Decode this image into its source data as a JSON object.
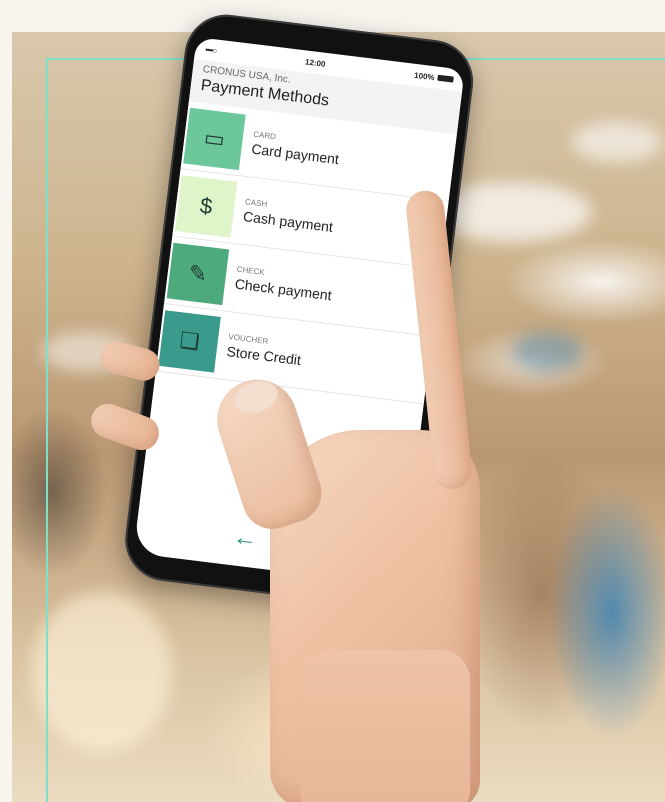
{
  "status_bar": {
    "signal": "••••○",
    "time": "12:00",
    "battery": "100%"
  },
  "header": {
    "company": "CRONUS USA, Inc.",
    "title": "Payment Methods"
  },
  "payment_methods": [
    {
      "kind": "CARD",
      "label": "Card payment",
      "icon": "credit-card-icon"
    },
    {
      "kind": "CASH",
      "label": "Cash payment",
      "icon": "banknote-icon"
    },
    {
      "kind": "CHECK",
      "label": "Check payment",
      "icon": "check-document-icon"
    },
    {
      "kind": "VOUCHER",
      "label": "Store Credit",
      "icon": "voucher-icon"
    }
  ],
  "nav": {
    "back": "back-arrow-icon",
    "search": "search-icon"
  },
  "colors": {
    "accent": "#2f8c74",
    "frame": "#7fe0c9",
    "card": "#6cc79a",
    "cash": "#dff5c9",
    "check": "#4daa7b",
    "voucher": "#3a9b8c"
  }
}
